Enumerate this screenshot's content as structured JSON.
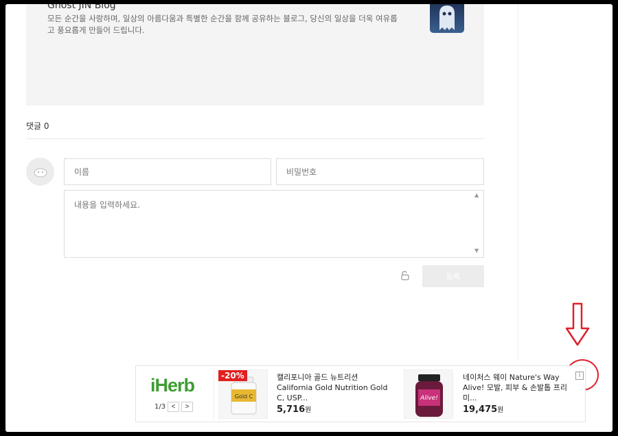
{
  "blog": {
    "title": "Ghost JIN Blog",
    "description": "모든 순간을 사랑하며, 일상의 아름다움과 특별한 순간을 함께 공유하는 블로그, 당신의 일상을 더욱 여유롭고 풍요롭게 만들어 드립니다."
  },
  "comments": {
    "count_label": "댓글 0",
    "name_placeholder": "이름",
    "password_placeholder": "비밀번호",
    "content_placeholder": "내용을 입력하세요.",
    "submit_label": "등록"
  },
  "ad": {
    "logo": "iHerb",
    "page_indicator": "1/3",
    "prev_label": "<",
    "next_label": ">",
    "info_label": "i",
    "products": [
      {
        "badge": "-20%",
        "title": "캘리포니아 골드 뉴트리션 California Gold Nutrition Gold C, USP...",
        "price": "5,716",
        "currency": "원"
      },
      {
        "title": "네이처스 웨이 Nature's Way Alive! 모발, 피부 & 손발톱 프리미...",
        "price": "19,475",
        "currency": "원"
      }
    ]
  },
  "colors": {
    "annotation": "#e0202a",
    "brand_green": "#3f9d34",
    "badge_red": "#e02020"
  }
}
